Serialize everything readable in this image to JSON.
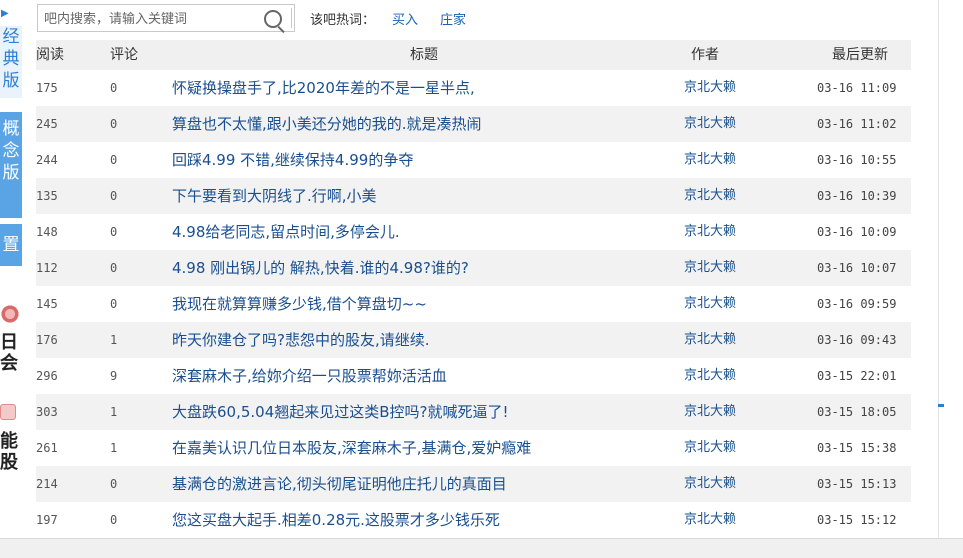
{
  "sidebar": {
    "arrow": "▶",
    "tab1": [
      "经",
      "典",
      "版"
    ],
    "tab2": [
      "概",
      "念",
      "版"
    ],
    "tab3": "置",
    "promo1": [
      "日",
      "会"
    ],
    "promo2": [
      "能",
      "股"
    ]
  },
  "search": {
    "placeholder": "吧内搜索，请输入关键词"
  },
  "hot": {
    "label": "该吧热词：",
    "keywords": [
      "买入",
      "庄家"
    ]
  },
  "table": {
    "headers": {
      "read": "阅读",
      "comments": "评论",
      "title": "标题",
      "author": "作者",
      "updated": "最后更新"
    },
    "rows": [
      {
        "read": "175",
        "comments": "0",
        "title": "怀疑换操盘手了,比2020年差的不是一星半点,",
        "author": "京北大赖",
        "updated": "03-16 11:09"
      },
      {
        "read": "245",
        "comments": "0",
        "title": "算盘也不太懂,跟小美还分她的我的.就是凑热闹",
        "author": "京北大赖",
        "updated": "03-16 11:02"
      },
      {
        "read": "244",
        "comments": "0",
        "title": "回踩4.99 不错,继续保持4.99的争夺",
        "author": "京北大赖",
        "updated": "03-16 10:55"
      },
      {
        "read": "135",
        "comments": "0",
        "title": "下午要看到大阴线了.行啊,小美",
        "author": "京北大赖",
        "updated": "03-16 10:39"
      },
      {
        "read": "148",
        "comments": "0",
        "title": "4.98给老同志,留点时间,多停会儿.",
        "author": "京北大赖",
        "updated": "03-16 10:09"
      },
      {
        "read": "112",
        "comments": "0",
        "title": "4.98 刚出锅儿的 解热,快着.谁的4.98?谁的?",
        "author": "京北大赖",
        "updated": "03-16 10:07"
      },
      {
        "read": "145",
        "comments": "0",
        "title": "我现在就算算赚多少钱,借个算盘切~~",
        "author": "京北大赖",
        "updated": "03-16 09:59"
      },
      {
        "read": "176",
        "comments": "1",
        "title": "昨天你建仓了吗?悲怨中的股友,请继续.",
        "author": "京北大赖",
        "updated": "03-16 09:43"
      },
      {
        "read": "296",
        "comments": "9",
        "title": "深套麻木子,给妳介绍一只股票帮妳活活血",
        "author": "京北大赖",
        "updated": "03-15 22:01"
      },
      {
        "read": "303",
        "comments": "1",
        "title": "大盘跌60,5.04翘起来见过这类B控吗?就喊死逼了!",
        "author": "京北大赖",
        "updated": "03-15 18:05"
      },
      {
        "read": "261",
        "comments": "1",
        "title": "在嘉美认识几位日本股友,深套麻木子,基满仓,爱妒瘾难",
        "author": "京北大赖",
        "updated": "03-15 15:38"
      },
      {
        "read": "214",
        "comments": "0",
        "title": "基满仓的激进言论,彻头彻尾证明他庄托儿的真面目",
        "author": "京北大赖",
        "updated": "03-15 15:13"
      },
      {
        "read": "197",
        "comments": "0",
        "title": "您这买盘大起手.相差0.28元.这股票才多少钱乐死",
        "author": "京北大赖",
        "updated": "03-15 15:12"
      }
    ]
  },
  "colors": {
    "accent_blue": "#5aa4e6",
    "link": "#1a4f8f",
    "row_alt": "#f2f2f2"
  }
}
